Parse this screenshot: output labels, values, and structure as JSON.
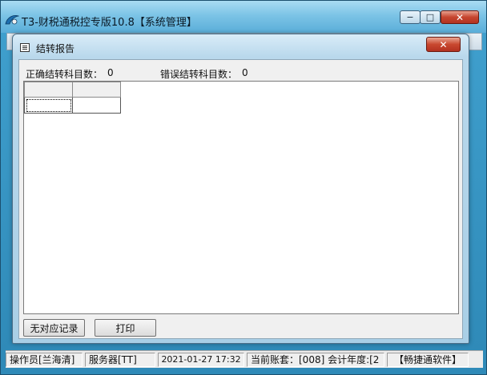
{
  "main_window": {
    "title": "T3-财税通税控专版10.8【系统管理】",
    "min_label": "−",
    "max_label": "□",
    "close_label": "✕"
  },
  "dialog": {
    "title": "结转报告",
    "close_label": "✕",
    "correct_label": "正确结转科目数：",
    "correct_count": "0",
    "error_label": "错误结转科目数：",
    "error_count": "0",
    "grid": {
      "headers": [
        "",
        ""
      ],
      "rows": [
        [
          "",
          ""
        ]
      ]
    },
    "buttons": {
      "no_record": "无对应记录",
      "print": "打印"
    }
  },
  "statusbar": {
    "operator": "操作员[兰海清]",
    "server": "服务器[TT]",
    "datetime": "2021-01-27 17:32",
    "account": "当前账套：[008] 会计年度:[2",
    "vendor": "【畅捷通软件】"
  }
}
